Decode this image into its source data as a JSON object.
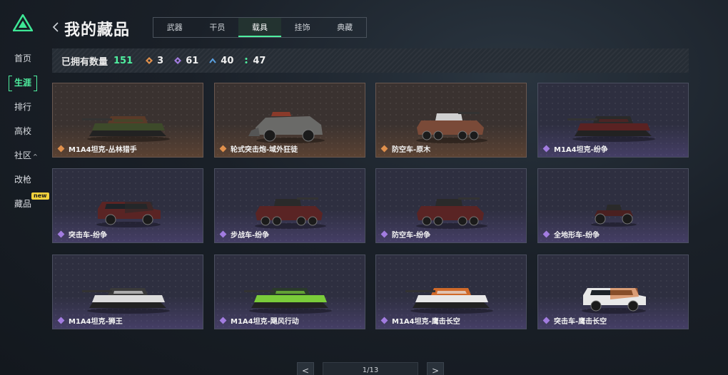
{
  "sidebar": {
    "items": [
      {
        "label": "首页"
      },
      {
        "label": "生涯"
      },
      {
        "label": "排行"
      },
      {
        "label": "高校"
      },
      {
        "label": "社区"
      },
      {
        "label": "改枪"
      },
      {
        "label": "藏品",
        "badge": "new"
      }
    ],
    "community_caret": "^"
  },
  "header": {
    "title": "我的藏品",
    "tabs": [
      {
        "label": "武器"
      },
      {
        "label": "干员"
      },
      {
        "label": "载具"
      },
      {
        "label": "挂饰"
      },
      {
        "label": "典藏"
      }
    ]
  },
  "stats": {
    "label": "已拥有数量",
    "total": "151",
    "counts": [
      {
        "icon": "orange-diamond-icon",
        "value": "3",
        "color": "#e0904c"
      },
      {
        "icon": "purple-diamond-icon",
        "value": "61",
        "color": "#a27ce0"
      },
      {
        "icon": "blue-chevron-icon",
        "value": "40",
        "color": "#5aa0e0"
      },
      {
        "icon": "green-dots-icon",
        "value": "47",
        "color": "#4ff0a0"
      }
    ]
  },
  "items": [
    {
      "name": "M1A4坦克-丛林猎手",
      "rarity": "orange",
      "vehicle": "tank",
      "colors": [
        "#3d4a2a",
        "#5a3a28"
      ]
    },
    {
      "name": "轮式突击炮-域外狂徒",
      "rarity": "orange",
      "vehicle": "armored-car",
      "colors": [
        "#6a6a68",
        "#8a3a2a"
      ]
    },
    {
      "name": "防空车-原木",
      "rarity": "orange",
      "vehicle": "apc",
      "colors": [
        "#7a4a38",
        "#d0d0d0"
      ]
    },
    {
      "name": "M1A4坦克-纷争",
      "rarity": "purple",
      "vehicle": "tank",
      "colors": [
        "#5a2222",
        "#2a2a2a"
      ]
    },
    {
      "name": "突击车-纷争",
      "rarity": "purple",
      "vehicle": "jeep",
      "colors": [
        "#5a2424",
        "#2a2a2a"
      ]
    },
    {
      "name": "步战车-纷争",
      "rarity": "purple",
      "vehicle": "apc",
      "colors": [
        "#5a2424",
        "#2a2a2a"
      ]
    },
    {
      "name": "防空车-纷争",
      "rarity": "purple",
      "vehicle": "apc",
      "colors": [
        "#5a2424",
        "#2a2a2a"
      ]
    },
    {
      "name": "全地形车-纷争",
      "rarity": "purple",
      "vehicle": "atv",
      "colors": [
        "#4a2020",
        "#2a2a2a"
      ]
    },
    {
      "name": "M1A4坦克-狮王",
      "rarity": "purple",
      "vehicle": "tank",
      "colors": [
        "#dcdcdc",
        "#3a3a3a"
      ]
    },
    {
      "name": "M1A4坦克-飓风行动",
      "rarity": "purple",
      "vehicle": "tank",
      "colors": [
        "#7acc3a",
        "#2a3a2a"
      ]
    },
    {
      "name": "M1A4坦克-鹰击长空",
      "rarity": "purple",
      "vehicle": "tank",
      "colors": [
        "#e8e8e8",
        "#d06a2a"
      ]
    },
    {
      "name": "突击车-鹰击长空",
      "rarity": "purple",
      "vehicle": "jeep",
      "colors": [
        "#e8e8e8",
        "#d06a2a"
      ]
    }
  ],
  "pagination": {
    "prev": "<",
    "text": "1/13",
    "next": ">"
  }
}
